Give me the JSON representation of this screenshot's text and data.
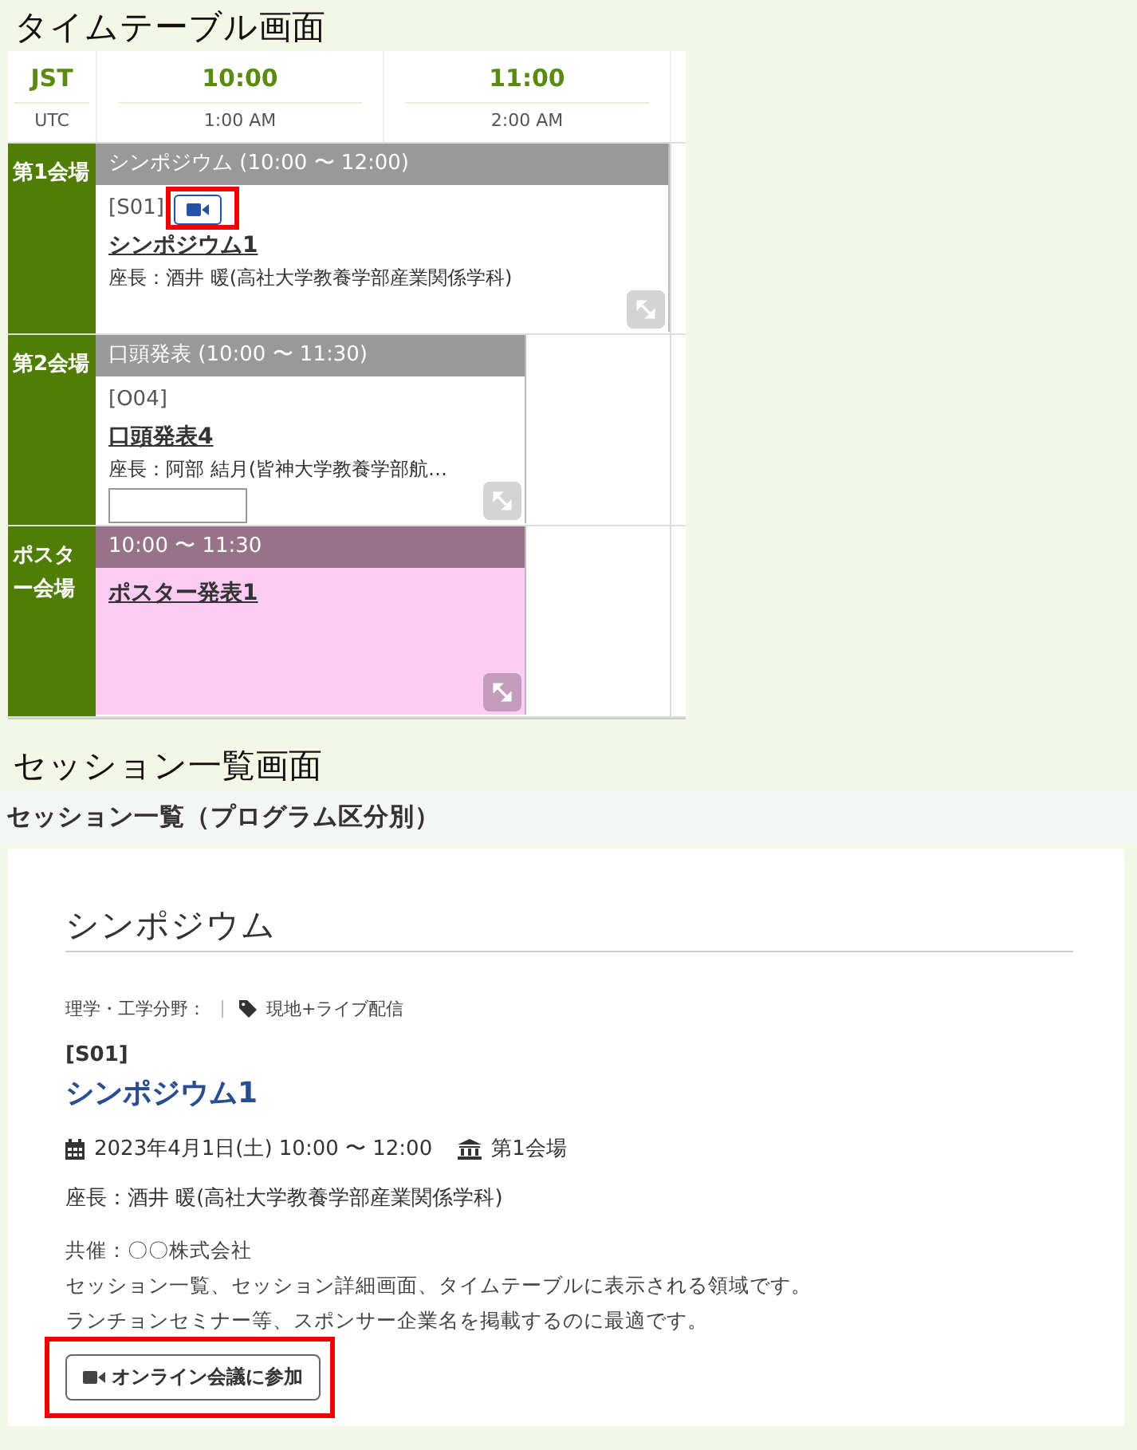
{
  "timetable_title": "タイムテーブル画面",
  "timetable": {
    "zone": "JST",
    "zone_sub": "UTC",
    "hours": [
      {
        "time": "10:00",
        "utc": "1:00 AM"
      },
      {
        "time": "11:00",
        "utc": "2:00 AM"
      }
    ],
    "rooms": [
      {
        "name": "第1会場",
        "session": {
          "kind": "symposium",
          "header": "シンポジウム (10:00 〜 12:00)",
          "code": "[S01]",
          "video": true,
          "highlighted": true,
          "title": "シンポジウム1",
          "chair": "座長：酒井 暖(高社大学教養学部産業関係学科)"
        }
      },
      {
        "name": "第2会場",
        "session": {
          "kind": "oral",
          "header": "口頭発表 (10:00 〜 11:30)",
          "code": "[O04]",
          "video": false,
          "highlighted": false,
          "title": "口頭発表4",
          "chair": "座長：阿部 結月(皆神大学教養学部航…",
          "cut_button": true
        }
      },
      {
        "name": "ポスター会場",
        "session": {
          "kind": "poster",
          "header": "10:00 〜 11:30",
          "title": "ポスター発表1"
        }
      }
    ]
  },
  "list_title": "セッション一覧画面",
  "list_heading": "セッション一覧（プログラム区分別）",
  "card": {
    "category": "シンポジウム",
    "field": "理学・工学分野：",
    "tag": "現地+ライブ配信",
    "code": "[S01]",
    "title": "シンポジウム1",
    "date": "2023年4月1日(土) 10:00 〜 12:00",
    "room": "第1会場",
    "chair": "座長：酒井 暖(高社大学教養学部産業関係学科)",
    "notes": [
      "共催：〇〇株式会社",
      "セッション一覧、セッション詳細画面、タイムテーブルに表示される領域です。",
      "ランチョンセミナー等、スポンサー企業名を掲載するのに最適です。"
    ],
    "join_button": {
      "label": "オンライン会議に参加",
      "highlighted": true
    }
  }
}
